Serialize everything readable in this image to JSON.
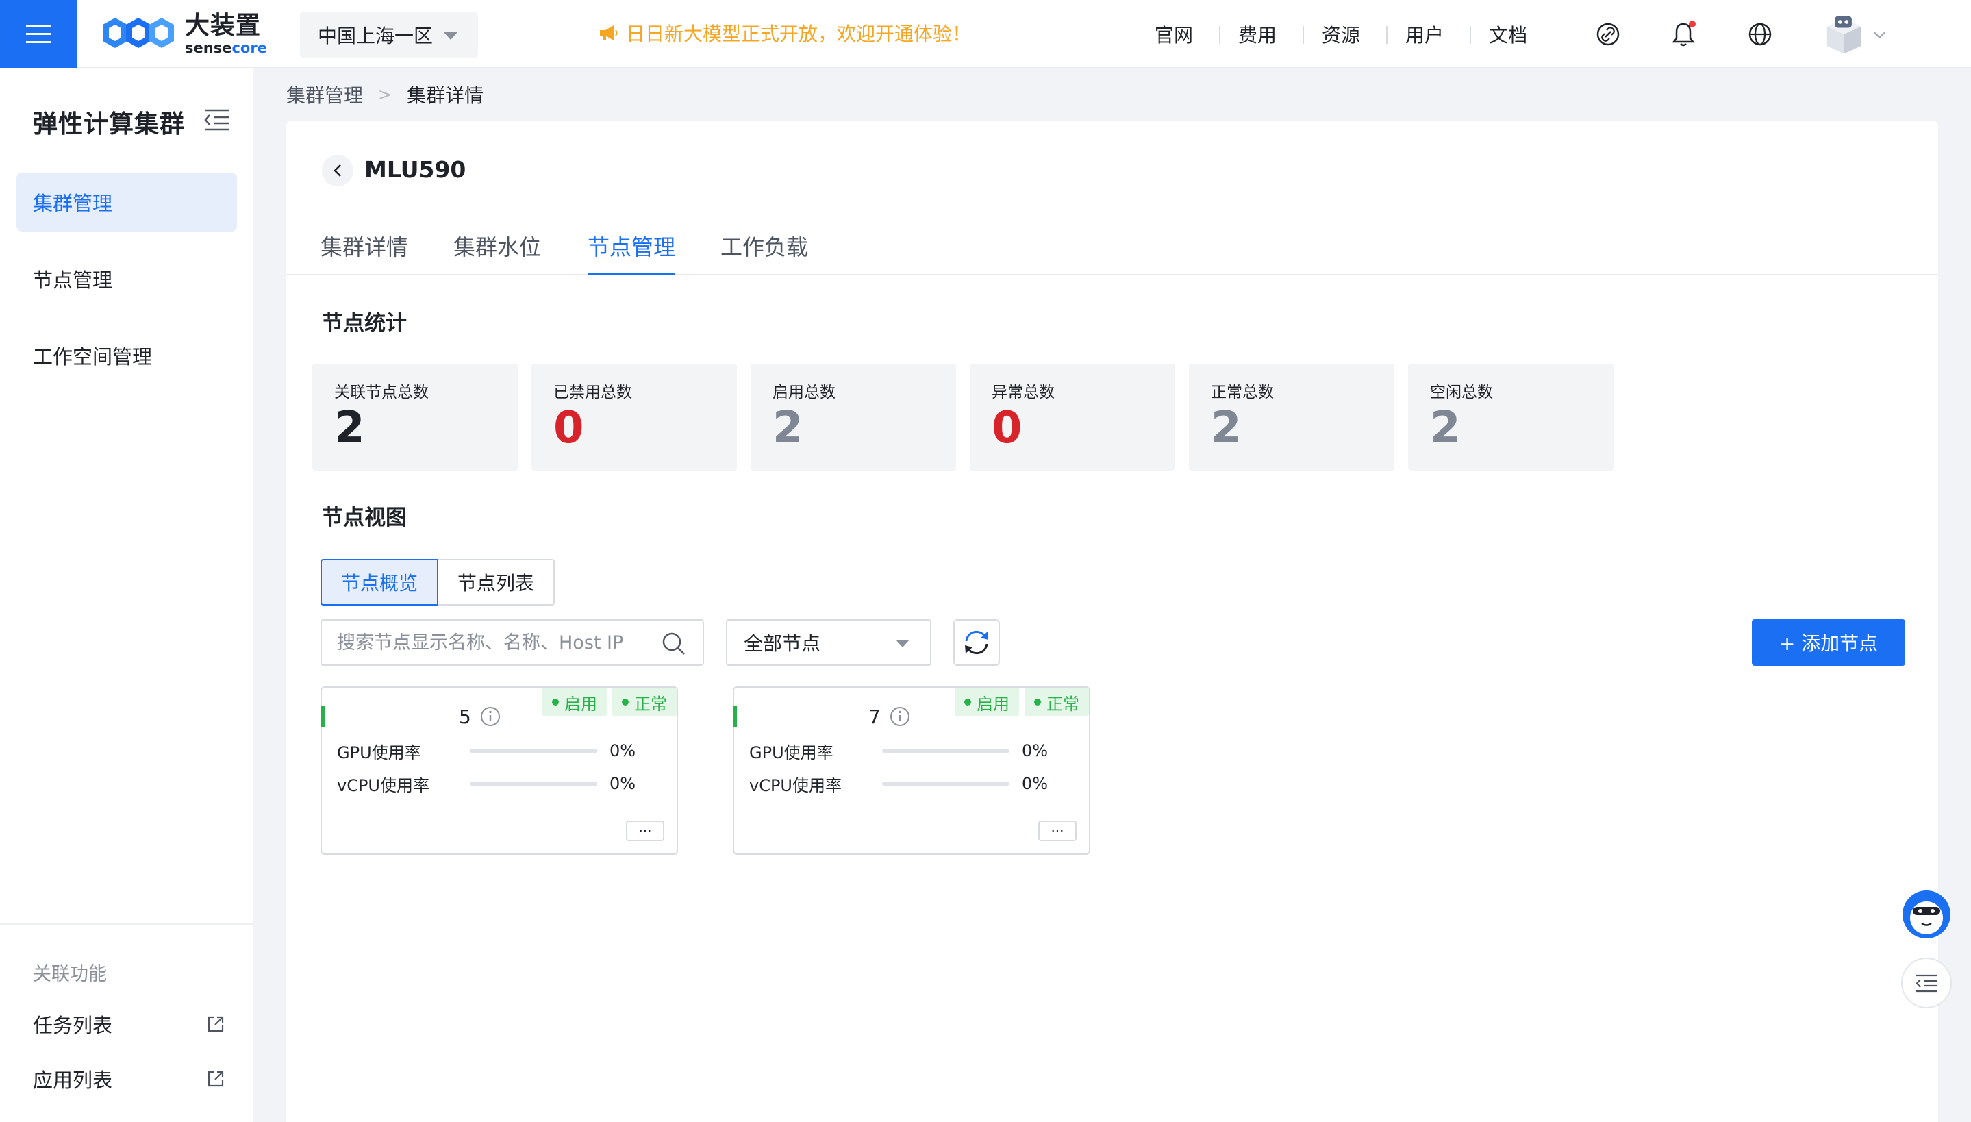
{
  "topbar": {
    "brand_cn": "大装置",
    "brand_en_prefix": "sense",
    "brand_en_suffix": "core",
    "region": "中国上海一区",
    "announcement": "日日新大模型正式开放，欢迎开通体验！",
    "nav": [
      "官网",
      "费用",
      "资源",
      "用户",
      "文档"
    ],
    "accent_color": "#1a6ff2",
    "announcement_color": "#f5a623"
  },
  "sidebar": {
    "title": "弹性计算集群",
    "items": [
      {
        "label": "集群管理",
        "active": true
      },
      {
        "label": "节点管理",
        "active": false
      },
      {
        "label": "工作空间管理",
        "active": false
      }
    ],
    "related_title": "关联功能",
    "related": [
      {
        "label": "任务列表",
        "icon": "external-link-icon"
      },
      {
        "label": "应用列表",
        "icon": "external-link-icon"
      }
    ]
  },
  "breadcrumb": {
    "parent": "集群管理",
    "current": "集群详情"
  },
  "page": {
    "title": "MLU590",
    "tabs": [
      "集群详情",
      "集群水位",
      "节点管理",
      "工作负载"
    ],
    "active_tab": "节点管理"
  },
  "stats": {
    "title": "节点统计",
    "items": [
      {
        "label": "关联节点总数",
        "value": "2",
        "color": "#1f2329"
      },
      {
        "label": "已禁用总数",
        "value": "0",
        "color": "#d6242a"
      },
      {
        "label": "启用总数",
        "value": "2",
        "color": "#7f8794"
      },
      {
        "label": "异常总数",
        "value": "0",
        "color": "#d6242a"
      },
      {
        "label": "正常总数",
        "value": "2",
        "color": "#7f8794"
      },
      {
        "label": "空闲总数",
        "value": "2",
        "color": "#7f8794"
      }
    ]
  },
  "view": {
    "title": "节点视图",
    "toggle": [
      "节点概览",
      "节点列表"
    ],
    "search_placeholder": "搜索节点显示名称、名称、Host IP",
    "filter_value": "全部节点",
    "add_button": "+ 添加节点"
  },
  "nodes": [
    {
      "name": "5",
      "badges": [
        "启用",
        "正常"
      ],
      "metrics": [
        {
          "label": "GPU使用率",
          "value": "0%",
          "fraction": 0
        },
        {
          "label": "vCPU使用率",
          "value": "0%",
          "fraction": 0
        }
      ],
      "more": "···"
    },
    {
      "name": "7",
      "badges": [
        "启用",
        "正常"
      ],
      "metrics": [
        {
          "label": "GPU使用率",
          "value": "0%",
          "fraction": 0
        },
        {
          "label": "vCPU使用率",
          "value": "0%",
          "fraction": 0
        }
      ],
      "more": "···"
    }
  ]
}
